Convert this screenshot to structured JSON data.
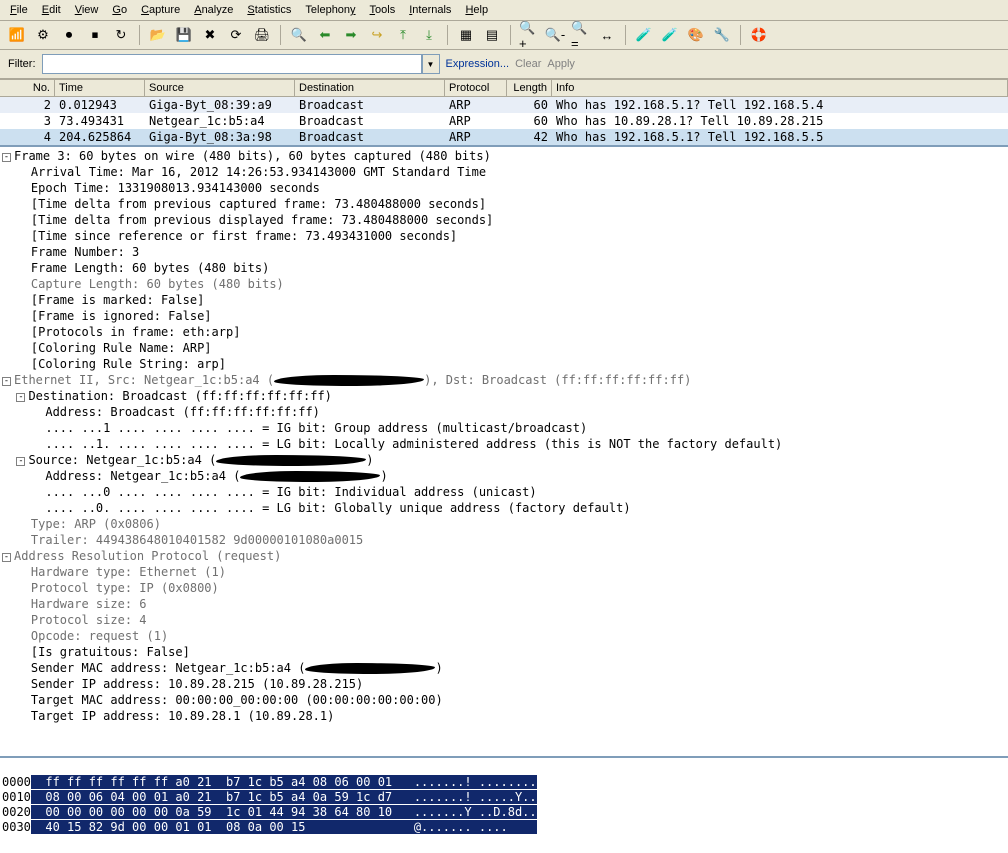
{
  "menu": {
    "file": "File",
    "edit": "Edit",
    "view": "View",
    "go": "Go",
    "capture": "Capture",
    "analyze": "Analyze",
    "statistics": "Statistics",
    "telephony": "Telephony",
    "tools": "Tools",
    "internals": "Internals",
    "help": "Help"
  },
  "filter": {
    "label": "Filter:",
    "value": "",
    "expression": "Expression...",
    "clear": "Clear",
    "apply": "Apply"
  },
  "columns": {
    "no": "No.",
    "time": "Time",
    "source": "Source",
    "destination": "Destination",
    "protocol": "Protocol",
    "length": "Length",
    "info": "Info"
  },
  "packets": [
    {
      "no": "2",
      "time": "0.012943",
      "src": "Giga-Byt_08:39:a9",
      "dst": "Broadcast",
      "proto": "ARP",
      "len": "60",
      "info": "Who has 192.168.5.1?  Tell 192.168.5.4"
    },
    {
      "no": "3",
      "time": "73.493431",
      "src": "Netgear_1c:b5:a4",
      "dst": "Broadcast",
      "proto": "ARP",
      "len": "60",
      "info": "Who has 10.89.28.1?  Tell 10.89.28.215"
    },
    {
      "no": "4",
      "time": "204.625864",
      "src": "Giga-Byt_08:3a:98",
      "dst": "Broadcast",
      "proto": "ARP",
      "len": "42",
      "info": "Who has 192.168.5.1?  Tell 192.168.5.5"
    }
  ],
  "frame": {
    "head": "Frame 3: 60 bytes on wire (480 bits), 60 bytes captured (480 bits)",
    "arrival": "Arrival Time: Mar 16, 2012 14:26:53.934143000 GMT Standard Time",
    "epoch": "Epoch Time: 1331908013.934143000 seconds",
    "delta_cap": "[Time delta from previous captured frame: 73.480488000 seconds]",
    "delta_disp": "[Time delta from previous displayed frame: 73.480488000 seconds]",
    "since_ref": "[Time since reference or first frame: 73.493431000 seconds]",
    "number": "Frame Number: 3",
    "length": "Frame Length: 60 bytes (480 bits)",
    "caplen": "Capture Length: 60 bytes (480 bits)",
    "marked": "[Frame is marked: False]",
    "ignored": "[Frame is ignored: False]",
    "protos": "[Protocols in frame: eth:arp]",
    "colname": "[Coloring Rule Name: ARP]",
    "colstr": "[Coloring Rule String: arp]"
  },
  "eth": {
    "head_pre": "Ethernet II, Src: Netgear_1c:b5:a4 (",
    "head_post": "), Dst: Broadcast (ff:ff:ff:ff:ff:ff)",
    "dst_head": "Destination: Broadcast (ff:ff:ff:ff:ff:ff)",
    "dst_addr": "Address: Broadcast (ff:ff:ff:ff:ff:ff)",
    "dst_ig": ".... ...1 .... .... .... .... = IG bit: Group address (multicast/broadcast)",
    "dst_lg": ".... ..1. .... .... .... .... = LG bit: Locally administered address (this is NOT the factory default)",
    "src_head": "Source: Netgear_1c:b5:a4 (",
    "src_addr": "Address: Netgear_1c:b5:a4 (",
    "src_ig": ".... ...0 .... .... .... .... = IG bit: Individual address (unicast)",
    "src_lg": ".... ..0. .... .... .... .... = LG bit: Globally unique address (factory default)",
    "type": "Type: ARP (0x0806)",
    "trailer": "Trailer: 449438648010401582 9d00000101080a0015"
  },
  "arp": {
    "head": "Address Resolution Protocol (request)",
    "hwtype": "Hardware type: Ethernet (1)",
    "ptype": "Protocol type: IP (0x0800)",
    "hwsize": "Hardware size: 6",
    "psize": "Protocol size: 4",
    "opcode": "Opcode: request (1)",
    "grat": "[Is gratuitous: False]",
    "smac_pre": "Sender MAC address: Netgear_1c:b5:a4 (",
    "smac_post": ")",
    "sip": "Sender IP address: 10.89.28.215 (10.89.28.215)",
    "tmac": "Target MAC address: 00:00:00_00:00:00 (00:00:00:00:00:00)",
    "tip": "Target IP address: 10.89.28.1 (10.89.28.1)"
  },
  "hex": {
    "l0_addr": "0000",
    "l0_hex": "  ff ff ff ff ff ff a0 21  b7 1c b5 a4 08 06 00 01",
    "l0_asc": "   .......! ........",
    "l1_addr": "0010",
    "l1_hex": "  08 00 06 04 00 01 a0 21  b7 1c b5 a4 0a 59 1c d7",
    "l1_asc": "   .......! .....Y..",
    "l2_addr": "0020",
    "l2_hex": "  00 00 00 00 00 00 0a 59  1c 01 44 94 38 64 80 10",
    "l2_asc": "   .......Y ..D.8d..",
    "l3_addr": "0030",
    "l3_hex": "  40 15 82 9d 00 00 01 01  08 0a 00 15",
    "l3_asc": "               @....... ....    "
  }
}
